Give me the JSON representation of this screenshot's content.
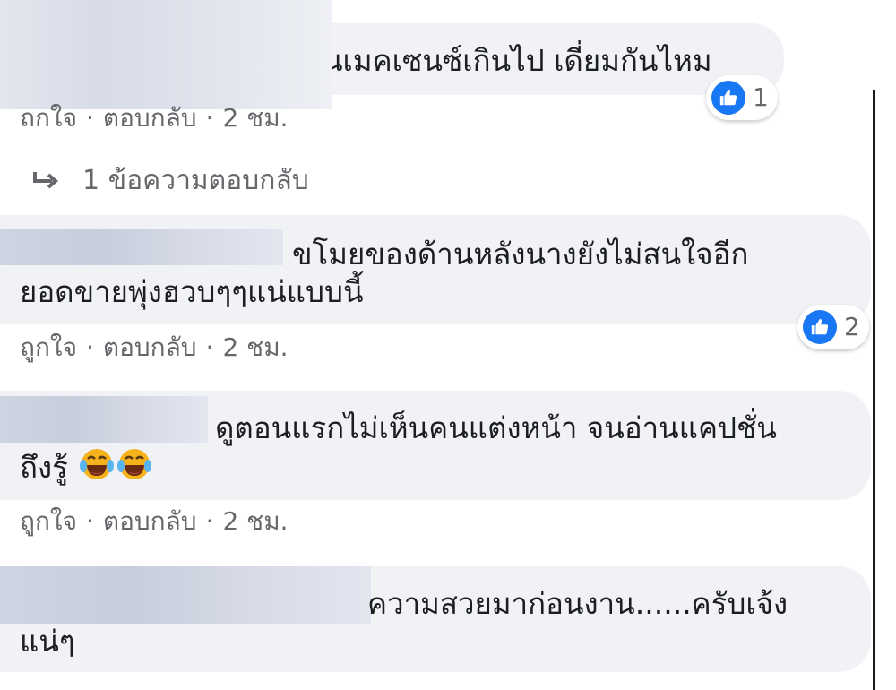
{
  "comments": [
    {
      "line1": "ันเมคเซนซ์เกินไป เดี่ยมกันไหม",
      "line2": "",
      "actions": {
        "like": "ถูกใจ",
        "reply": "ตอบกลับ",
        "time": "2 ชม."
      },
      "reaction_count": "1",
      "replies_link": "1 ข้อความตอบกลับ"
    },
    {
      "line1": "ขโมยของด้านหลังนางยังไม่สนใจอีก",
      "line2": "ยอดขายพุ่งฮวบๆๆแน่แบบนี้",
      "actions": {
        "like": "ถูกใจ",
        "reply": "ตอบกลับ",
        "time": "2 ชม."
      },
      "reaction_count": "2"
    },
    {
      "line1": "ดูตอนแรกไม่เห็นคนแต่งหน้า จนอ่านแคปชั่น",
      "line2": "ถึงรู้",
      "emoji": [
        "face-with-tears-of-joy",
        "face-with-tears-of-joy"
      ],
      "actions": {
        "like": "ถูกใจ",
        "reply": "ตอบกลับ",
        "time": "2 ชม."
      }
    },
    {
      "line1": "ความสวยมาก่อนงาน......ครับเจ้ง",
      "line2": "แน่ๆ"
    }
  ],
  "separator": "·",
  "icons": {
    "like": "thumbs-up-icon",
    "reply": "reply-arrow-icon",
    "emoji": "laughing-crying-emoji-icon"
  },
  "colors": {
    "bubble": "#f0f2f5",
    "like_blue": "#1877f2",
    "meta_text": "#65676b",
    "text": "#1c1e21"
  }
}
